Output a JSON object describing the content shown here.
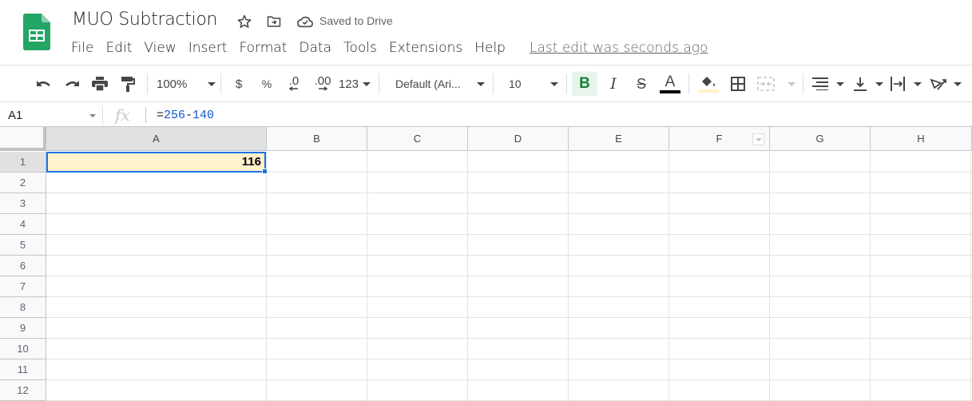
{
  "app": {
    "document_title": "MUO Subtraction",
    "save_status": "Saved to Drive",
    "last_edit": "Last edit was seconds ago",
    "brand_color": "#0f9d58"
  },
  "menu": [
    "File",
    "Edit",
    "View",
    "Insert",
    "Format",
    "Data",
    "Tools",
    "Extensions",
    "Help"
  ],
  "toolbar": {
    "zoom": "100%",
    "currency": "$",
    "percent": "%",
    "decrease_decimal": ".0",
    "increase_decimal": ".00",
    "more_formats": "123",
    "font": "Default (Ari...",
    "font_size": "10",
    "bold": "B",
    "italic": "I",
    "strikethrough": "S",
    "text_color_label": "A",
    "text_color": "#000000",
    "fill_color": "#fff2cc",
    "bold_active_color": "#188038"
  },
  "formula_bar": {
    "name_box": "A1",
    "fx": "fx",
    "formula_prefix": "=",
    "formula_left": "256",
    "formula_op": "-",
    "formula_right": "140"
  },
  "grid": {
    "columns": [
      "A",
      "B",
      "C",
      "D",
      "E",
      "F",
      "G",
      "H"
    ],
    "rows": [
      "1",
      "2",
      "3",
      "4",
      "5",
      "6",
      "7",
      "8",
      "9",
      "10",
      "11",
      "12"
    ],
    "selected_cell": "A1",
    "cells": {
      "A1": "116"
    }
  }
}
